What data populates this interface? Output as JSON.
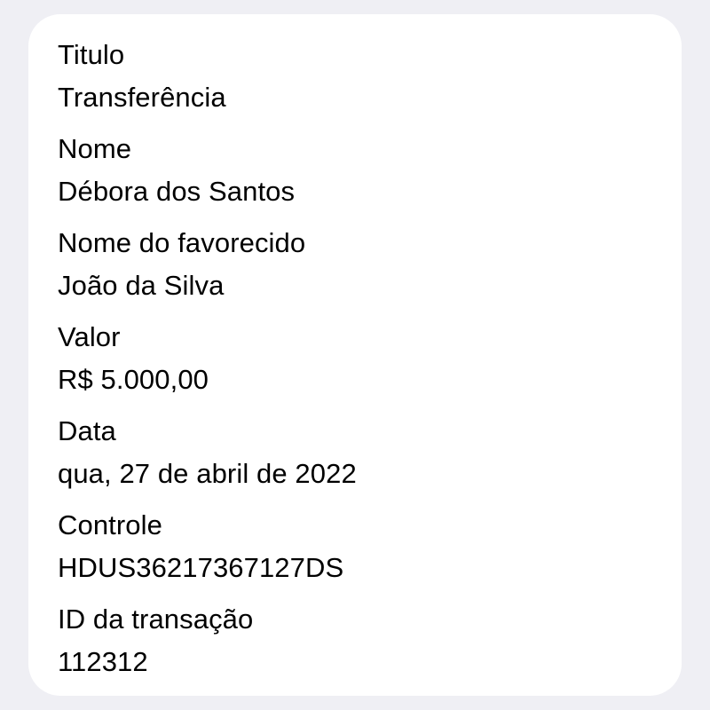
{
  "fields": [
    {
      "label": "Titulo",
      "value": "Transferência"
    },
    {
      "label": "Nome",
      "value": "Débora dos Santos"
    },
    {
      "label": "Nome do favorecido",
      "value": "João da Silva"
    },
    {
      "label": "Valor",
      "value": "R$ 5.000,00"
    },
    {
      "label": "Data",
      "value": "qua, 27 de abril de 2022"
    },
    {
      "label": "Controle",
      "value": "HDUS36217367127DS"
    },
    {
      "label": "ID da transação",
      "value": "112312"
    }
  ]
}
